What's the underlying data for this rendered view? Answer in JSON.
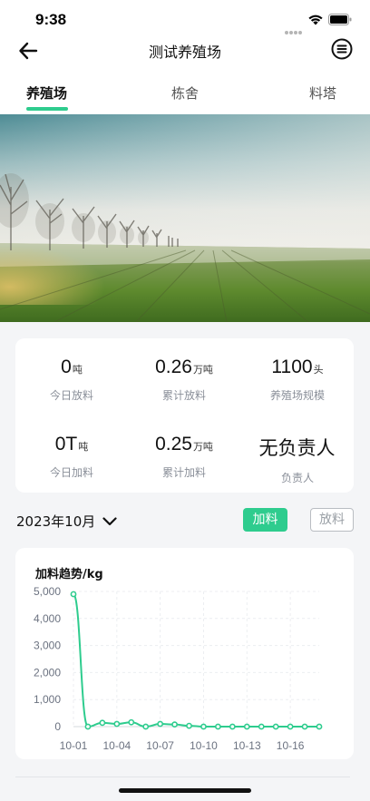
{
  "status": {
    "time": "9:38"
  },
  "nav": {
    "title": "测试养殖场"
  },
  "tabs": [
    {
      "label": "养殖场",
      "active": true
    },
    {
      "label": "栋舍",
      "active": false
    },
    {
      "label": "料塔",
      "active": false
    }
  ],
  "stats": [
    {
      "value": "0",
      "unit": "吨",
      "label": "今日放料"
    },
    {
      "value": "0.26",
      "unit": "万吨",
      "label": "累计放料"
    },
    {
      "value": "1100",
      "unit": "头",
      "label": "养殖场规模"
    },
    {
      "value": "0T",
      "unit": "吨",
      "label": "今日加料"
    },
    {
      "value": "0.25",
      "unit": "万吨",
      "label": "累计加料"
    },
    {
      "value": "无负责人",
      "unit": "",
      "label": "负责人"
    }
  ],
  "filter": {
    "month": "2023年10月",
    "add_label": "加料",
    "release_label": "放料"
  },
  "colors": {
    "accent": "#2ecc8e"
  },
  "chart_data": {
    "type": "line",
    "title": "加料趋势/kg",
    "x": [
      "10-01",
      "10-02",
      "10-03",
      "10-04",
      "10-05",
      "10-06",
      "10-07",
      "10-08",
      "10-09",
      "10-10",
      "10-11",
      "10-12",
      "10-13",
      "10-14",
      "10-15",
      "10-16",
      "10-17",
      "10-18"
    ],
    "x_tick_labels": [
      "10-01",
      "10-04",
      "10-07",
      "10-10",
      "10-13",
      "10-16"
    ],
    "series": [
      {
        "values": [
          4900,
          0,
          140,
          100,
          160,
          0,
          100,
          80,
          30,
          0,
          0,
          0,
          0,
          0,
          0,
          0,
          0,
          0
        ]
      }
    ],
    "y_ticks": [
      "0",
      "1,000",
      "2,000",
      "3,000",
      "4,000",
      "5,000"
    ],
    "ylim": [
      0,
      5000
    ],
    "grid": true,
    "line_color": "#2ecc8e"
  }
}
